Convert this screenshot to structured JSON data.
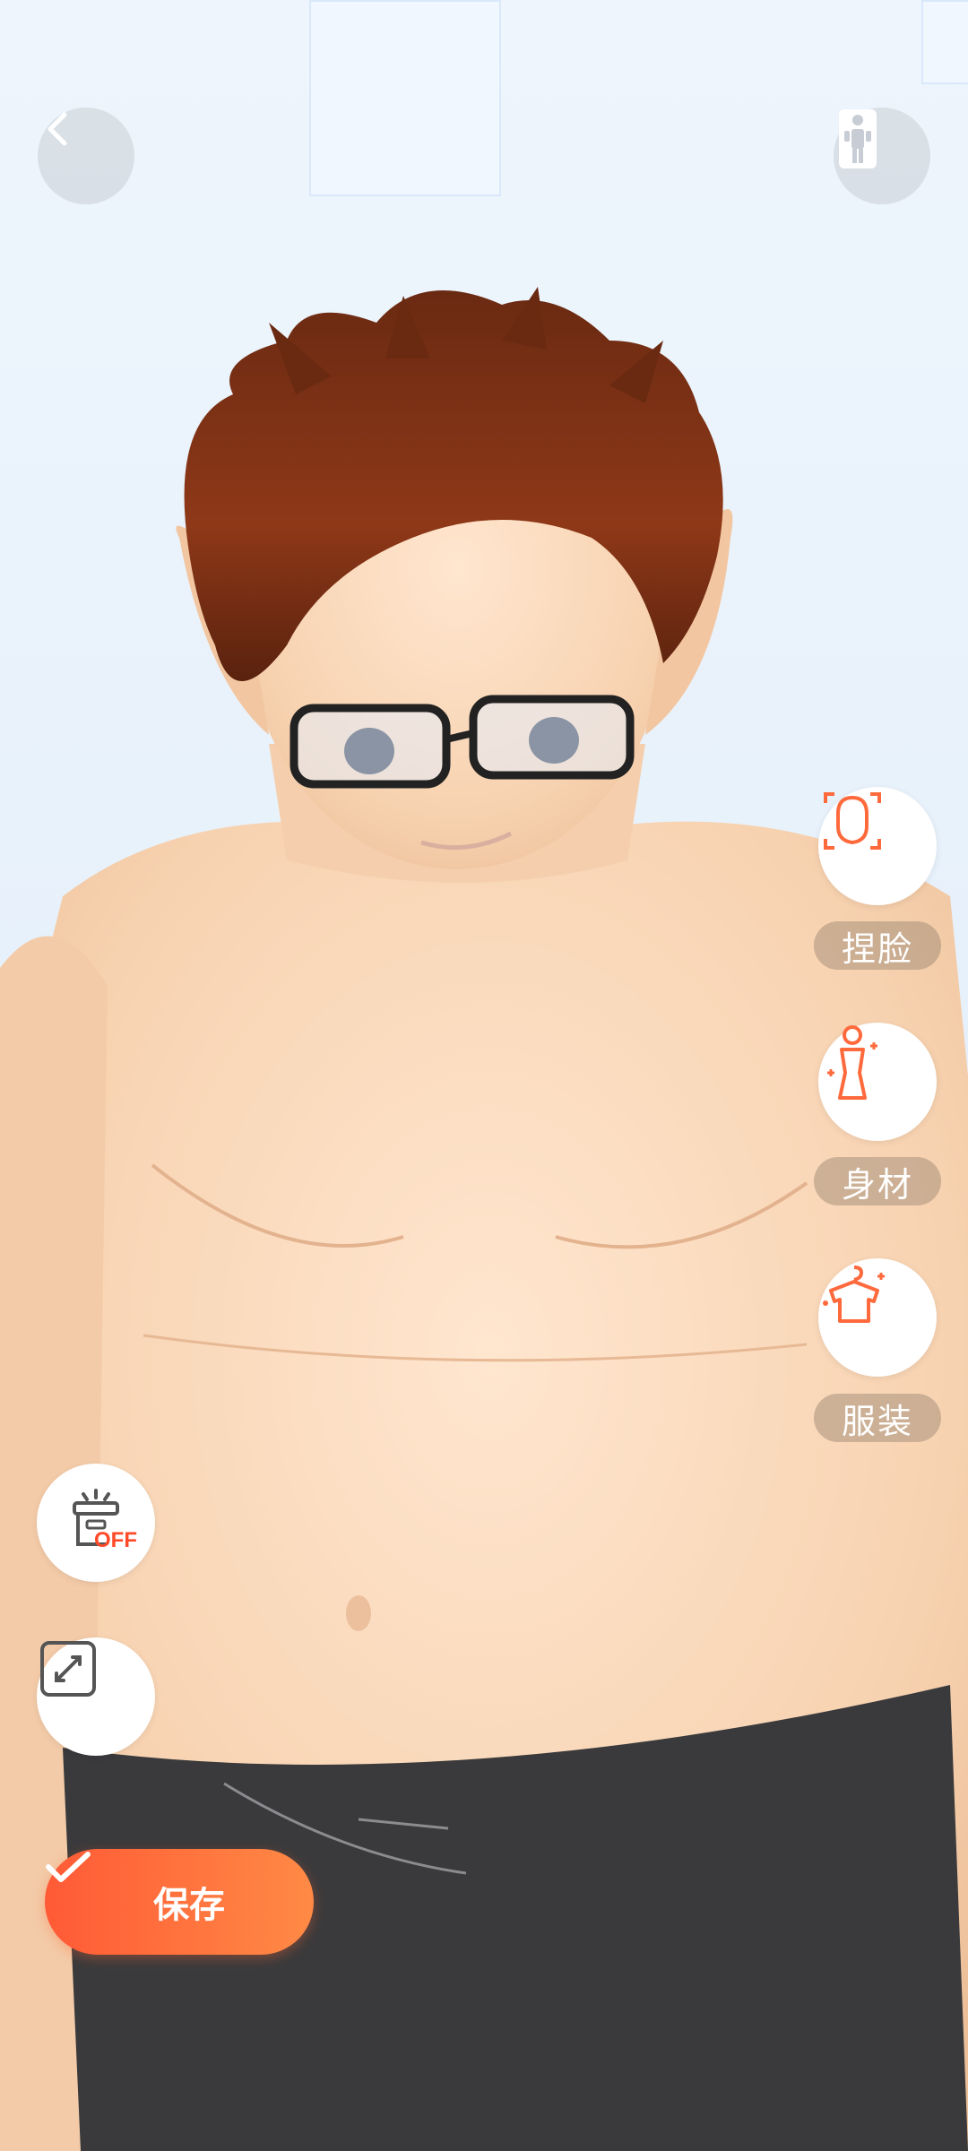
{
  "app": {
    "colors": {
      "accent": "#ff6a3d",
      "label_bg": "#9a8674",
      "icon_bg": "#ffffff"
    }
  },
  "top_bar": {
    "back_icon": "chevron-left-icon",
    "pose_icon": "person-pose-icon"
  },
  "side_menu": {
    "items": [
      {
        "label": "捏脸",
        "icon": "face-shape-icon"
      },
      {
        "label": "身材",
        "icon": "body-shape-icon"
      },
      {
        "label": "服装",
        "icon": "clothing-hanger-icon"
      }
    ]
  },
  "left_tools": {
    "scene_toggle": {
      "state_text": "OFF",
      "icon": "lamp-off-icon"
    },
    "fullscreen": {
      "icon": "expand-icon"
    }
  },
  "save_button": {
    "label": "保存",
    "icon": "check-icon"
  }
}
